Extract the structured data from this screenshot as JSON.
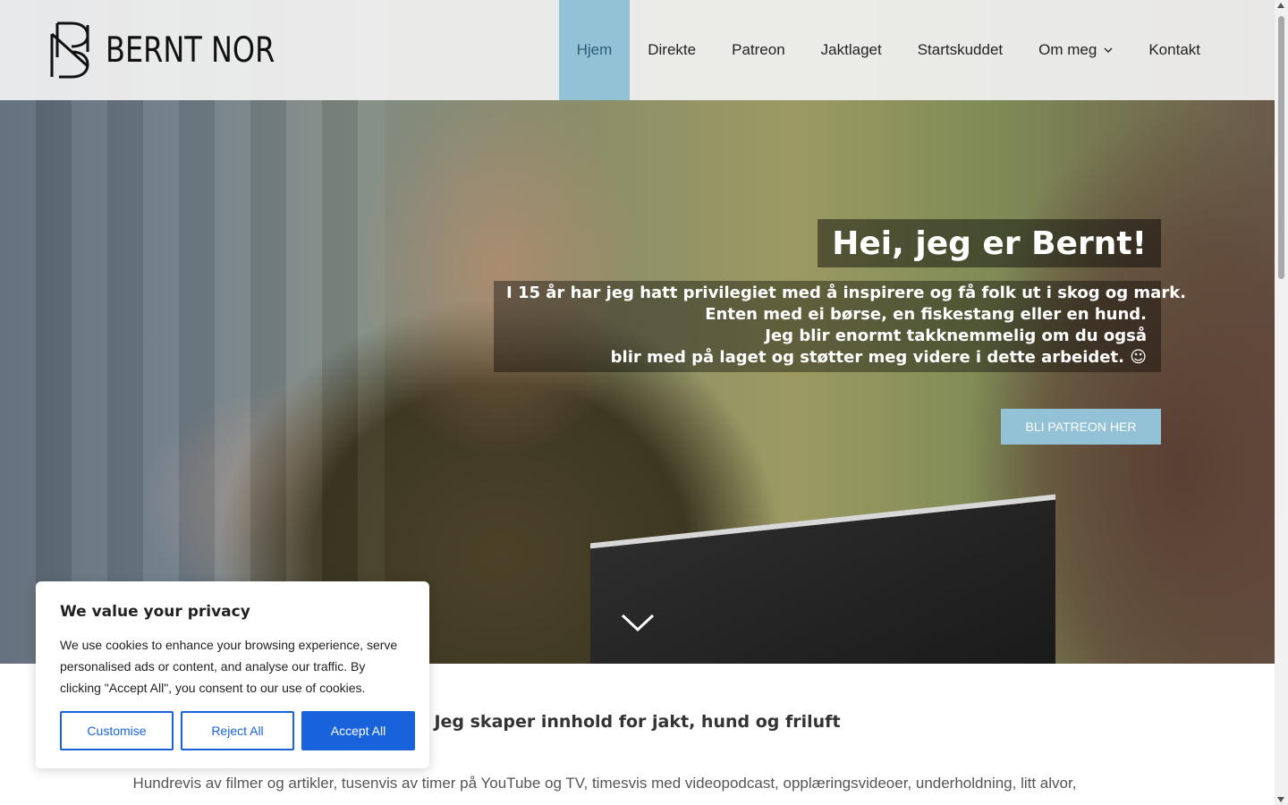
{
  "header": {
    "brand": "BERNT NOR",
    "nav": [
      {
        "label": "Hjem"
      },
      {
        "label": "Direkte"
      },
      {
        "label": "Patreon"
      },
      {
        "label": "Jaktlaget"
      },
      {
        "label": "Startskuddet"
      },
      {
        "label": "Om meg"
      },
      {
        "label": "Kontakt"
      }
    ],
    "active_nav": "Hjem"
  },
  "hero": {
    "title": "Hei, jeg er Bernt!",
    "lines": [
      "I 15 år har jeg hatt privilegiet med å inspirere og få folk ut i skog og mark.",
      "Enten med ei børse, en fiskestang eller en hund.",
      "Jeg blir enormt takknemmelig om du også",
      "blir med på laget og støtter meg videre i dette arbeidet. ☺"
    ],
    "cta_label": "BLI PATREON HER"
  },
  "content": {
    "heading": "Jeg skaper innhold for jakt, hund og friluft",
    "body": "Hundrevis av filmer og artikler, tusenvis av timer på YouTube og TV, timesvis med videopodcast, opplæringsvideoer, underholdning, litt alvor,"
  },
  "cookie_banner": {
    "title": "We value your privacy",
    "text": "We use cookies to enhance your browsing experience, serve personalised ads or content, and analyse our traffic. By clicking \"Accept All\", you consent to our use of cookies.",
    "customise_label": "Customise",
    "reject_label": "Reject All",
    "accept_label": "Accept All"
  },
  "colors": {
    "accent": "#93c2d6",
    "cookie_blue": "#1863dc",
    "header_bg": "#f0f0f0"
  },
  "icons": [
    "logo-monogram-icon",
    "chevron-down-icon",
    "scroll-down-chevron-icon"
  ]
}
